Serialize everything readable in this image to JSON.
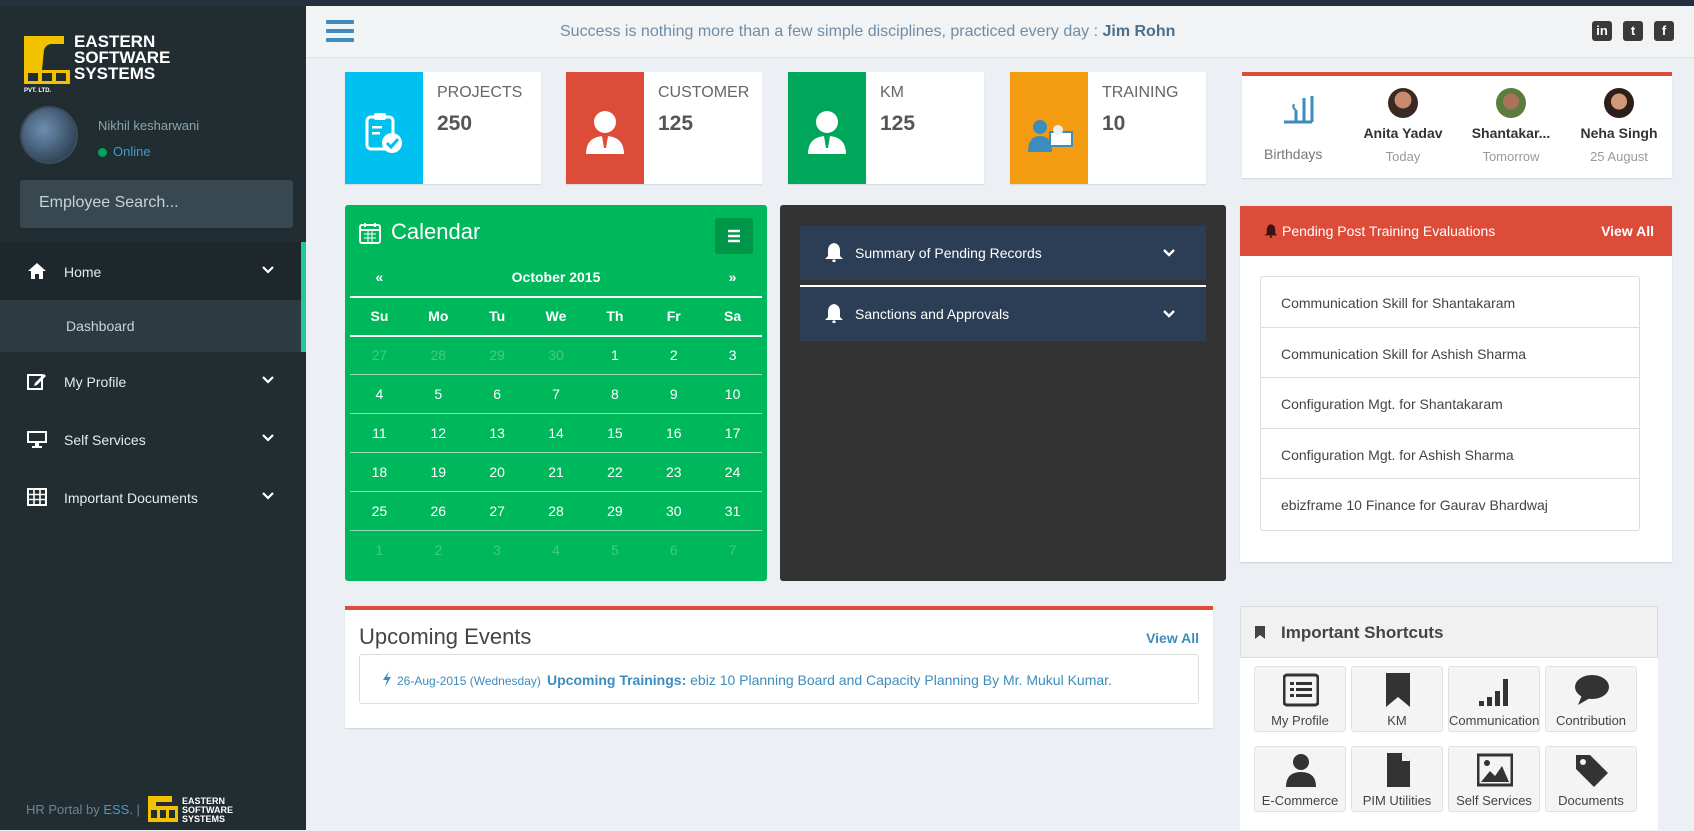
{
  "brand": {
    "line1": "EASTERN",
    "line2": "SOFTWARE",
    "line3": "SYSTEMS",
    "tag": "PVT. LTD."
  },
  "user": {
    "name": "Nikhil kesharwani",
    "status": "Online"
  },
  "search": {
    "placeholder": "Employee Search..."
  },
  "nav": {
    "home": "Home",
    "dashboard": "Dashboard",
    "my_profile": "My Profile",
    "self_services": "Self Services",
    "important_documents": "Important Documents"
  },
  "footer": {
    "prefix": "HR Portal by ",
    "link": "ESS.",
    "sep": " |"
  },
  "header": {
    "quote": "Success is nothing more than a few simple disciplines, practiced every day : ",
    "author": "Jim Rohn"
  },
  "social": {
    "linkedin": "in",
    "twitter": "t",
    "facebook": "f"
  },
  "stats": [
    {
      "label": "PROJECTS",
      "value": "250",
      "color": "#00c0ef"
    },
    {
      "label": "CUSTOMER",
      "value": "125",
      "color": "#dd4b39"
    },
    {
      "label": "KM",
      "value": "125",
      "color": "#00a65a"
    },
    {
      "label": "TRAINING",
      "value": "10",
      "color": "#f39c12"
    }
  ],
  "birthdays": {
    "label": "Birthdays",
    "people": [
      {
        "name": "Anita Yadav",
        "date": "Today"
      },
      {
        "name": "Shantakar...",
        "date": "Tomorrow"
      },
      {
        "name": "Neha Singh",
        "date": "25 August"
      }
    ]
  },
  "calendar": {
    "title": "Calendar",
    "prev": "«",
    "next": "»",
    "month": "October 2015",
    "days": [
      "Su",
      "Mo",
      "Tu",
      "We",
      "Th",
      "Fr",
      "Sa"
    ],
    "weeks": [
      [
        "27",
        "28",
        "29",
        "30",
        "1",
        "2",
        "3"
      ],
      [
        "4",
        "5",
        "6",
        "7",
        "8",
        "9",
        "10"
      ],
      [
        "11",
        "12",
        "13",
        "14",
        "15",
        "16",
        "17"
      ],
      [
        "18",
        "19",
        "20",
        "21",
        "22",
        "23",
        "24"
      ],
      [
        "25",
        "26",
        "27",
        "28",
        "29",
        "30",
        "31"
      ],
      [
        "1",
        "2",
        "3",
        "4",
        "5",
        "6",
        "7"
      ]
    ]
  },
  "accordion": {
    "pending": "Summary of Pending Records",
    "sanctions": "Sanctions and Approvals"
  },
  "pending_eval": {
    "title": "Pending Post Training Evaluations",
    "view_all": "View All",
    "items": [
      "Communication Skill for Shantakaram",
      "Communication Skill for Ashish Sharma",
      "Configuration Mgt. for Shantakaram",
      "Configuration Mgt. for Ashish Sharma",
      "ebizframe 10 Finance for Gaurav Bhardwaj"
    ]
  },
  "events": {
    "title": "Upcoming Events",
    "view_all": "View All",
    "date": "26-Aug-2015 (Wednesday)",
    "kind": "Upcoming Trainings:",
    "text": " ebiz 10 Planning Board and Capacity Planning By Mr. Mukul Kumar."
  },
  "shortcuts": {
    "title": "Important Shortcuts",
    "items": [
      "My Profile",
      "KM",
      "Communication",
      "Contribution",
      "E-Commerce",
      "PIM Utilities",
      "Self Services",
      "Documents"
    ]
  }
}
